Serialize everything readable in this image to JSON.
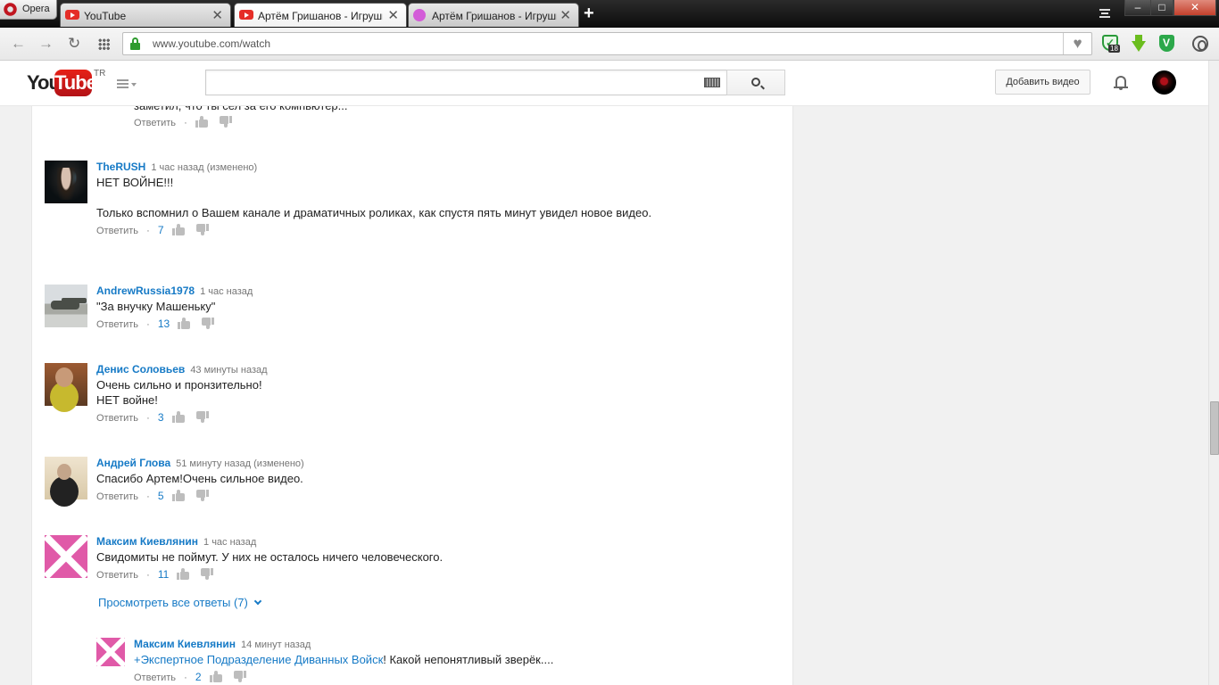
{
  "browser": {
    "opera_label": "Opera",
    "tabs": [
      {
        "title": "YouTube",
        "active": false
      },
      {
        "title": "Артём Гришанов - Игрушки",
        "active": true
      },
      {
        "title": "Артём Гришанов - Игрушки",
        "active": false
      }
    ],
    "url": "www.youtube.com/watch",
    "extension_badge": "18",
    "window_buttons": {
      "minimize": "–",
      "maximize": "□",
      "close": "✕"
    }
  },
  "masthead": {
    "logo_you": "You",
    "logo_tube": "Tube",
    "region": "TR",
    "search_placeholder": "",
    "upload_label": "Добавить видео"
  },
  "comments": [
    {
      "author": "",
      "time": "",
      "text": [
        "заметил, что ты сел за его компьютер..."
      ],
      "reply_label": "Ответить",
      "likes": ""
    },
    {
      "author": "TheRUSH",
      "time": "1 час назад (изменено)",
      "text": [
        "НЕТ ВОЙНЕ!!!",
        "",
        "Только вспомнил о Вашем канале и драматичных роликах, как спустя пять минут увидел новое видео."
      ],
      "reply_label": "Ответить",
      "likes": "7"
    },
    {
      "author": "AndrewRussia1978",
      "time": "1 час назад",
      "text": [
        "\"За внучку Машеньку\""
      ],
      "reply_label": "Ответить",
      "likes": "13"
    },
    {
      "author": "Денис Соловьев",
      "time": "43 минуты назад",
      "text": [
        "Очень сильно и пронзительно!",
        "НЕТ войне!"
      ],
      "reply_label": "Ответить",
      "likes": "3"
    },
    {
      "author": "Андрей Глова",
      "time": "51 минуту назад (изменено)",
      "text": [
        "Спасибо Артем!Очень сильное видео."
      ],
      "reply_label": "Ответить",
      "likes": "5"
    },
    {
      "author": "Максим Киевлянин",
      "time": "1 час назад",
      "text": [
        "Свидомиты не поймут. У них не осталось ничего человеческого."
      ],
      "reply_label": "Ответить",
      "likes": "11"
    }
  ],
  "view_replies_label": "Просмотреть все ответы (7)",
  "reply": {
    "author": "Максим Киевлянин",
    "time": "14 минут назад",
    "mention": "+Экспертное Подразделение Диванных Войск",
    "text": "! Какой непонятливый зверёк....",
    "reply_label": "Ответить",
    "likes": "2"
  }
}
